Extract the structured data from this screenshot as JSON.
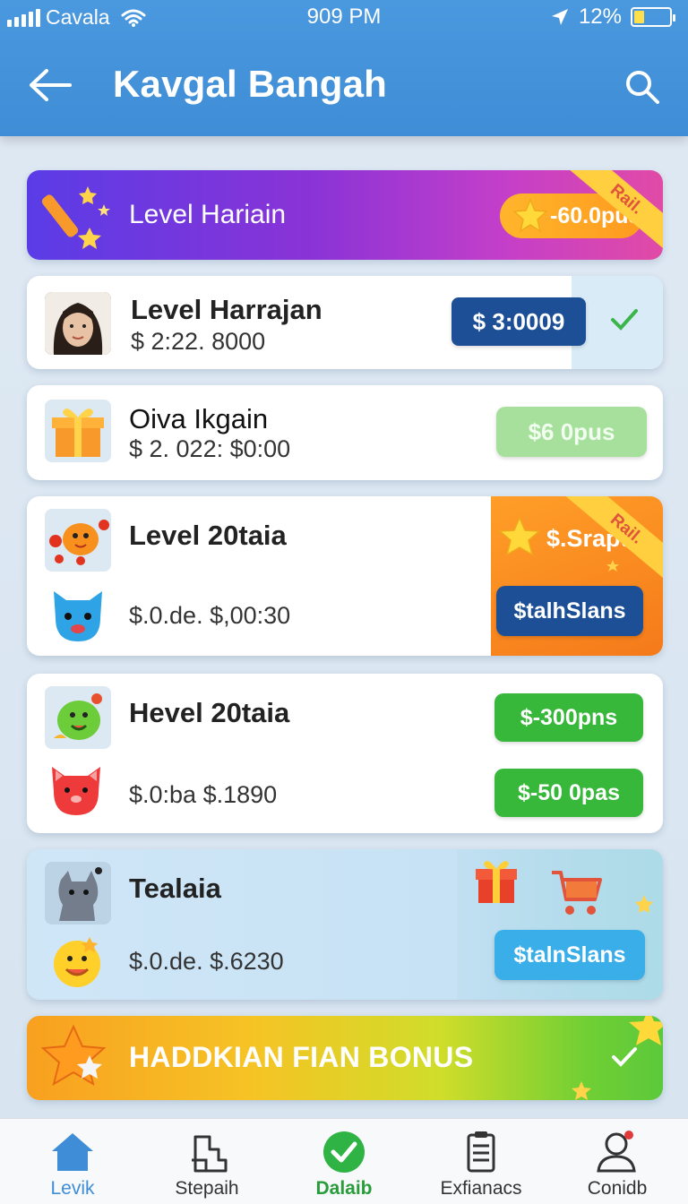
{
  "status_bar": {
    "carrier": "Cavala",
    "time": "909 PM",
    "battery": "12%"
  },
  "header": {
    "title": "Kavgal Bangah"
  },
  "banner": {
    "title": "Level Hariain",
    "pill": "-60.0pus",
    "ribbon": "Rail."
  },
  "items": [
    {
      "name": "Level Harrajan",
      "amount": "$ 2:22. 8000",
      "button": "$ 3:0009",
      "button_color": "#1d4f96"
    },
    {
      "name": "Oiva Ikgain",
      "amount": "$ 2. 022: $0:00",
      "button": "$6 0pus",
      "button_color": "#a6e09c"
    },
    {
      "name": "Level 20taia",
      "amount": "$.0.de. $,00:30",
      "badge": "$.Srapu",
      "ribbon": "Rail.",
      "button": "$talhSlans",
      "button_color": "#1d4f96"
    },
    {
      "name": "Hevel 20taia",
      "amount": "$.0:ba $.1890",
      "button_top": "$-300pns",
      "button_bottom": "$-50 0pas",
      "button_color": "#38b83a"
    },
    {
      "name": "Tealaia",
      "amount": "$.0.de. $.6230",
      "button": "$talnSlans",
      "button_color": "#3aaee9"
    }
  ],
  "bonus": {
    "label": "HADDKIAN FIAN BONUS"
  },
  "bottom_nav": [
    {
      "label": "Levik",
      "icon": "home-icon",
      "active": true
    },
    {
      "label": "Stepaih",
      "icon": "steps-icon",
      "active": false
    },
    {
      "label": "Dalaib",
      "icon": "check-circle-icon",
      "active": false
    },
    {
      "label": "Exfianacs",
      "icon": "clipboard-icon",
      "active": false
    },
    {
      "label": "Conidb",
      "icon": "profile-icon",
      "active": false
    }
  ]
}
